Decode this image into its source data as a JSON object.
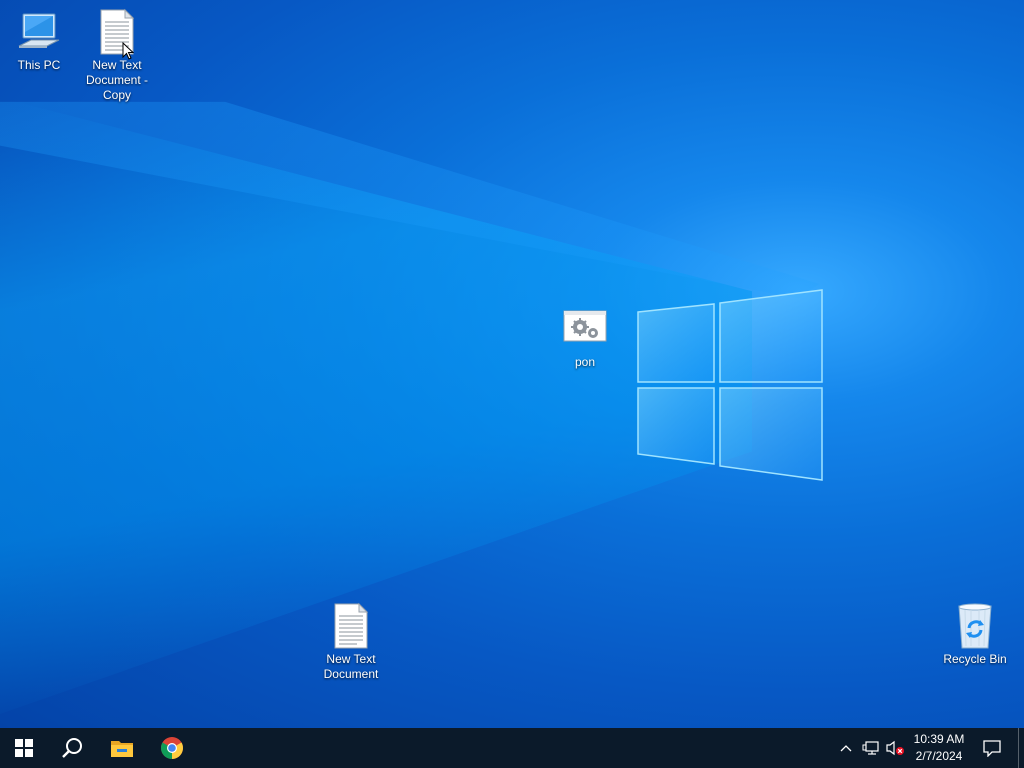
{
  "desktop": {
    "icons": [
      {
        "label": "This PC",
        "icon": "this-pc-icon"
      },
      {
        "label": "New Text Document - Copy",
        "icon": "text-document-icon"
      },
      {
        "label": "pon",
        "icon": "batch-file-icon"
      },
      {
        "label": "New Text Document",
        "icon": "text-document-icon"
      },
      {
        "label": "Recycle Bin",
        "icon": "recycle-bin-icon"
      }
    ]
  },
  "taskbar": {
    "items": [
      {
        "name": "start-button",
        "icon": "windows-logo-icon"
      },
      {
        "name": "search-button",
        "icon": "search-icon"
      },
      {
        "name": "file-explorer-button",
        "icon": "folder-icon"
      },
      {
        "name": "chrome-button",
        "icon": "chrome-icon"
      }
    ],
    "tray": {
      "time": "10:39 AM",
      "date": "2/7/2024",
      "icons": [
        "chevron-up-icon",
        "network-icon",
        "volume-muted-icon",
        "notification-icon"
      ]
    },
    "background_color": "#0b1a2a"
  },
  "colors": {
    "accent": "#0078d7",
    "wallpaper_light": "#36a9ff",
    "wallpaper_dark": "#0443a8"
  }
}
